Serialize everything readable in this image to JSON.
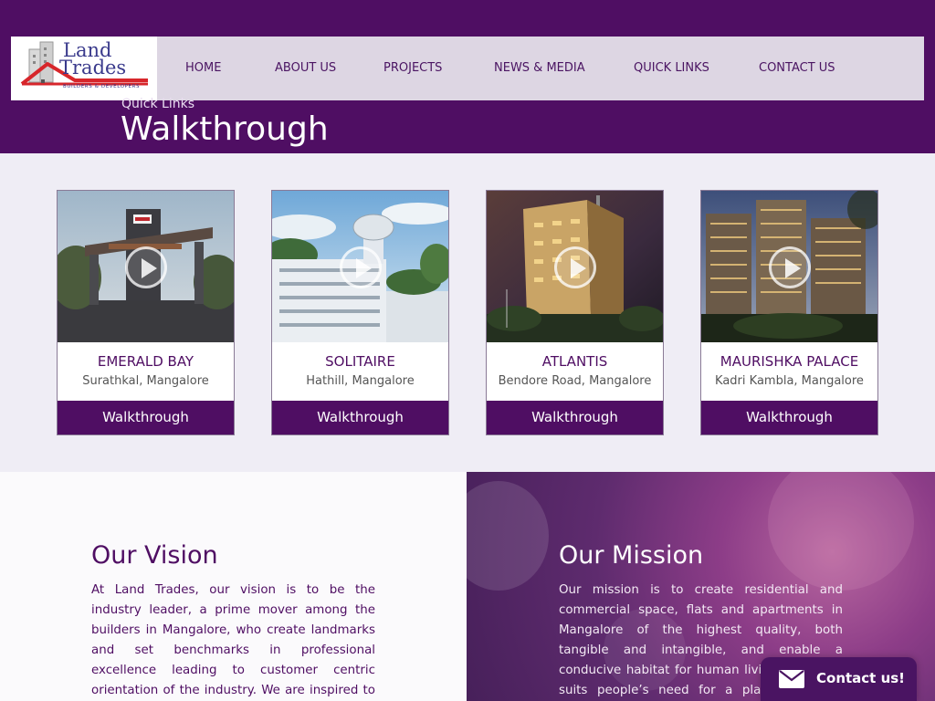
{
  "brand": {
    "logo_line1": "Land",
    "logo_line2": "Trades",
    "logo_tagline": "BUILDERS & DEVELOPERS"
  },
  "nav": {
    "items": [
      "HOME",
      "ABOUT US",
      "PROJECTS",
      "NEWS & MEDIA",
      "QUICK LINKS",
      "CONTACT US"
    ]
  },
  "page": {
    "breadcrumb": "Quick Links",
    "title": "Walkthrough"
  },
  "projects": [
    {
      "name": "EMERALD BAY",
      "location": "Surathkal, Mangalore",
      "button": "Walkthrough",
      "icon": "play-icon"
    },
    {
      "name": "SOLITAIRE",
      "location": "Hathill, Mangalore",
      "button": "Walkthrough",
      "icon": "play-icon"
    },
    {
      "name": "ATLANTIS",
      "location": "Bendore Road, Mangalore",
      "button": "Walkthrough",
      "icon": "play-icon"
    },
    {
      "name": "MAURISHKA PALACE",
      "location": "Kadri Kambla, Mangalore",
      "button": "Walkthrough",
      "icon": "play-icon"
    }
  ],
  "vision": {
    "title": "Our Vision",
    "text": "At Land Trades, our vision is to be the industry leader, a prime mover among the builders in Mangalore, who create landmarks and set benchmarks in professional excellence leading to customer centric orientation of the industry. We are inspired to act only in the best interests"
  },
  "mission": {
    "title": "Our Mission",
    "text": "Our mission is to create residential and commercial space, flats and apartments in Mangalore of the highest quality, both tangible and intangible, and enable a conducive habitat for human living that most suits people’s need for a place they call home."
  },
  "contact_widget": {
    "label": "Contact us!",
    "icon": "mail-icon"
  },
  "colors": {
    "brand_purple": "#4f0e63",
    "nav_bg": "#ddd6e3",
    "logo_red": "#d7262b",
    "logo_blue": "#3a3a8c"
  }
}
